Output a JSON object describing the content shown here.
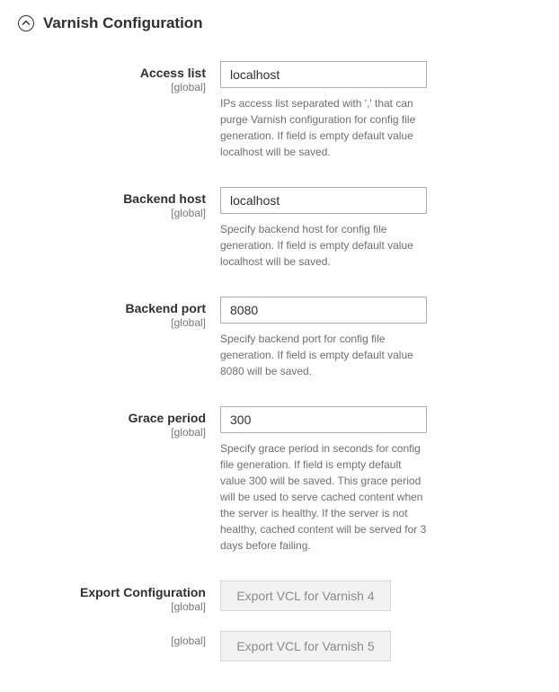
{
  "section": {
    "title": "Varnish Configuration"
  },
  "fields": {
    "access_list": {
      "label": "Access list",
      "scope": "[global]",
      "value": "localhost",
      "help": "IPs access list separated with ',' that can purge Varnish configuration for config file generation. If field is empty default value localhost will be saved."
    },
    "backend_host": {
      "label": "Backend host",
      "scope": "[global]",
      "value": "localhost",
      "help": "Specify backend host for config file generation. If field is empty default value localhost will be saved."
    },
    "backend_port": {
      "label": "Backend port",
      "scope": "[global]",
      "value": "8080",
      "help": "Specify backend port for config file generation. If field is empty default value 8080 will be saved."
    },
    "grace_period": {
      "label": "Grace period",
      "scope": "[global]",
      "value": "300",
      "help": "Specify grace period in seconds for config file generation. If field is empty default value 300 will be saved. This grace period will be used to serve cached content when the server is healthy. If the server is not healthy, cached content will be served for 3 days before failing."
    },
    "export_config": {
      "label": "Export Configuration",
      "scope": "[global]",
      "button4": "Export VCL for Varnish 4"
    },
    "export_config5": {
      "scope": "[global]",
      "button5": "Export VCL for Varnish 5"
    }
  }
}
